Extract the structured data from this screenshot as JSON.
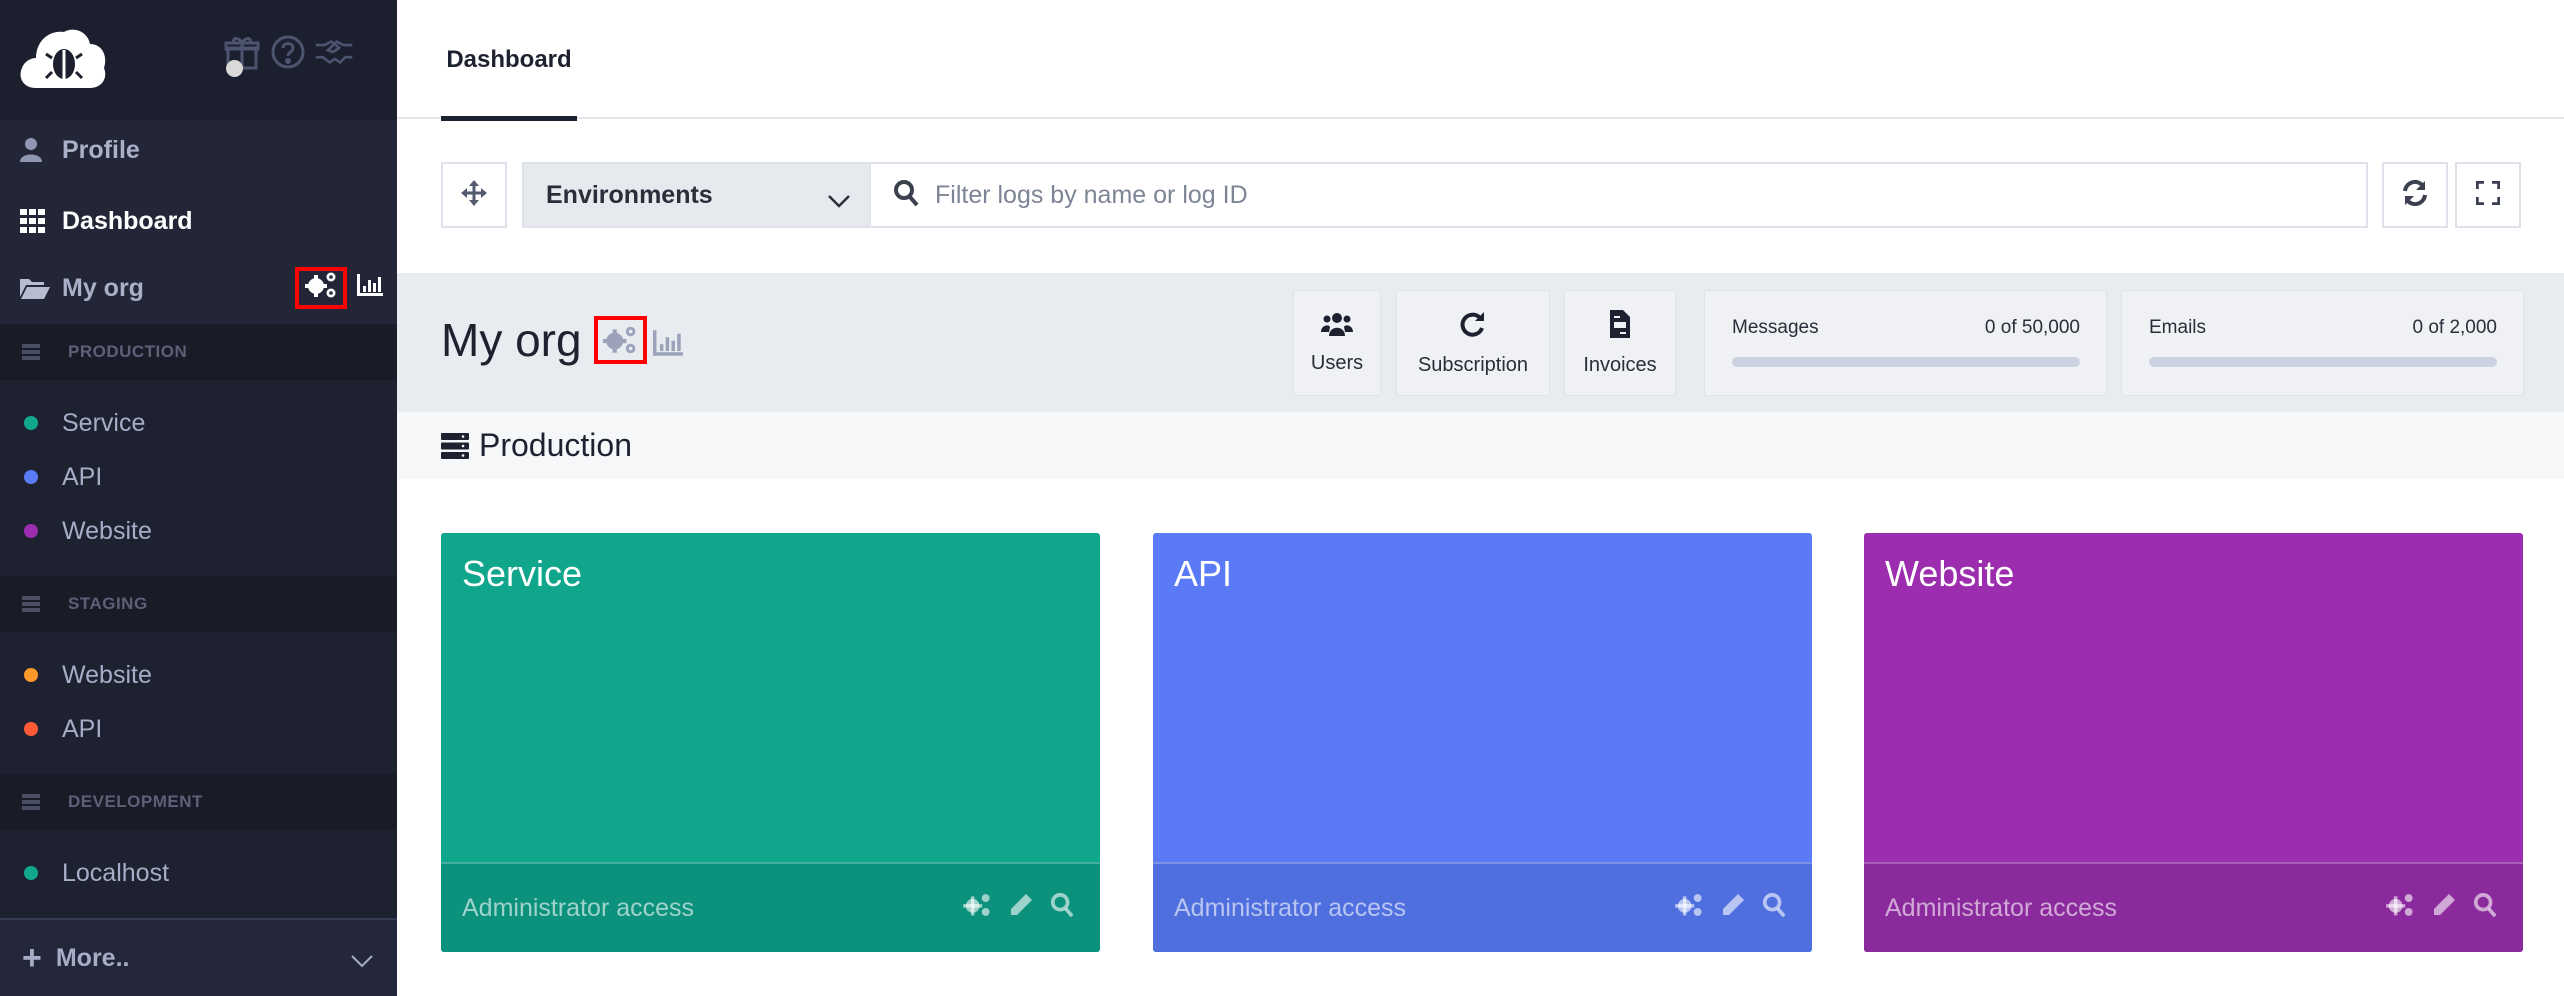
{
  "sidebar": {
    "top_icons": [
      {
        "name": "gift-icon"
      },
      {
        "name": "help-icon"
      },
      {
        "name": "handshake-icon"
      }
    ],
    "nav": {
      "profile": "Profile",
      "dashboard": "Dashboard",
      "my_org": "My org"
    },
    "environments": [
      {
        "title": "PRODUCTION",
        "items": [
          {
            "label": "Service",
            "color": "#11a88d"
          },
          {
            "label": "API",
            "color": "#5a7bf5"
          },
          {
            "label": "Website",
            "color": "#9c2daf"
          }
        ]
      },
      {
        "title": "STAGING",
        "items": [
          {
            "label": "Website",
            "color": "#ff9a2a"
          },
          {
            "label": "API",
            "color": "#ff5a36"
          }
        ]
      },
      {
        "title": "DEVELOPMENT",
        "items": [
          {
            "label": "Localhost",
            "color": "#11a88d"
          }
        ]
      }
    ],
    "more_label": "More.."
  },
  "main": {
    "tabs": [
      {
        "label": "Dashboard",
        "active": true
      }
    ],
    "toolbar": {
      "environments_label": "Environments",
      "search_placeholder": "Filter logs by name or log ID",
      "search_value": ""
    },
    "org": {
      "title": "My org",
      "buttons": [
        {
          "label": "Users",
          "icon": "users-icon"
        },
        {
          "label": "Subscription",
          "icon": "refresh-icon"
        },
        {
          "label": "Invoices",
          "icon": "invoice-icon"
        }
      ],
      "usage": [
        {
          "label": "Messages",
          "value": "0 of 50,000",
          "used": 0,
          "limit": 50000
        },
        {
          "label": "Emails",
          "value": "0 of 2,000",
          "used": 0,
          "limit": 2000
        }
      ]
    },
    "section_title": "Production",
    "cards": [
      {
        "name": "Service",
        "access": "Administrator access",
        "color": "#0fa68c",
        "foot_color": "#0c927c"
      },
      {
        "name": "API",
        "access": "Administrator access",
        "color": "#5a7bf5",
        "foot_color": "#4f6fdf"
      },
      {
        "name": "Website",
        "access": "Administrator access",
        "color": "#9c2dae",
        "foot_color": "#8b2a9c"
      }
    ]
  }
}
